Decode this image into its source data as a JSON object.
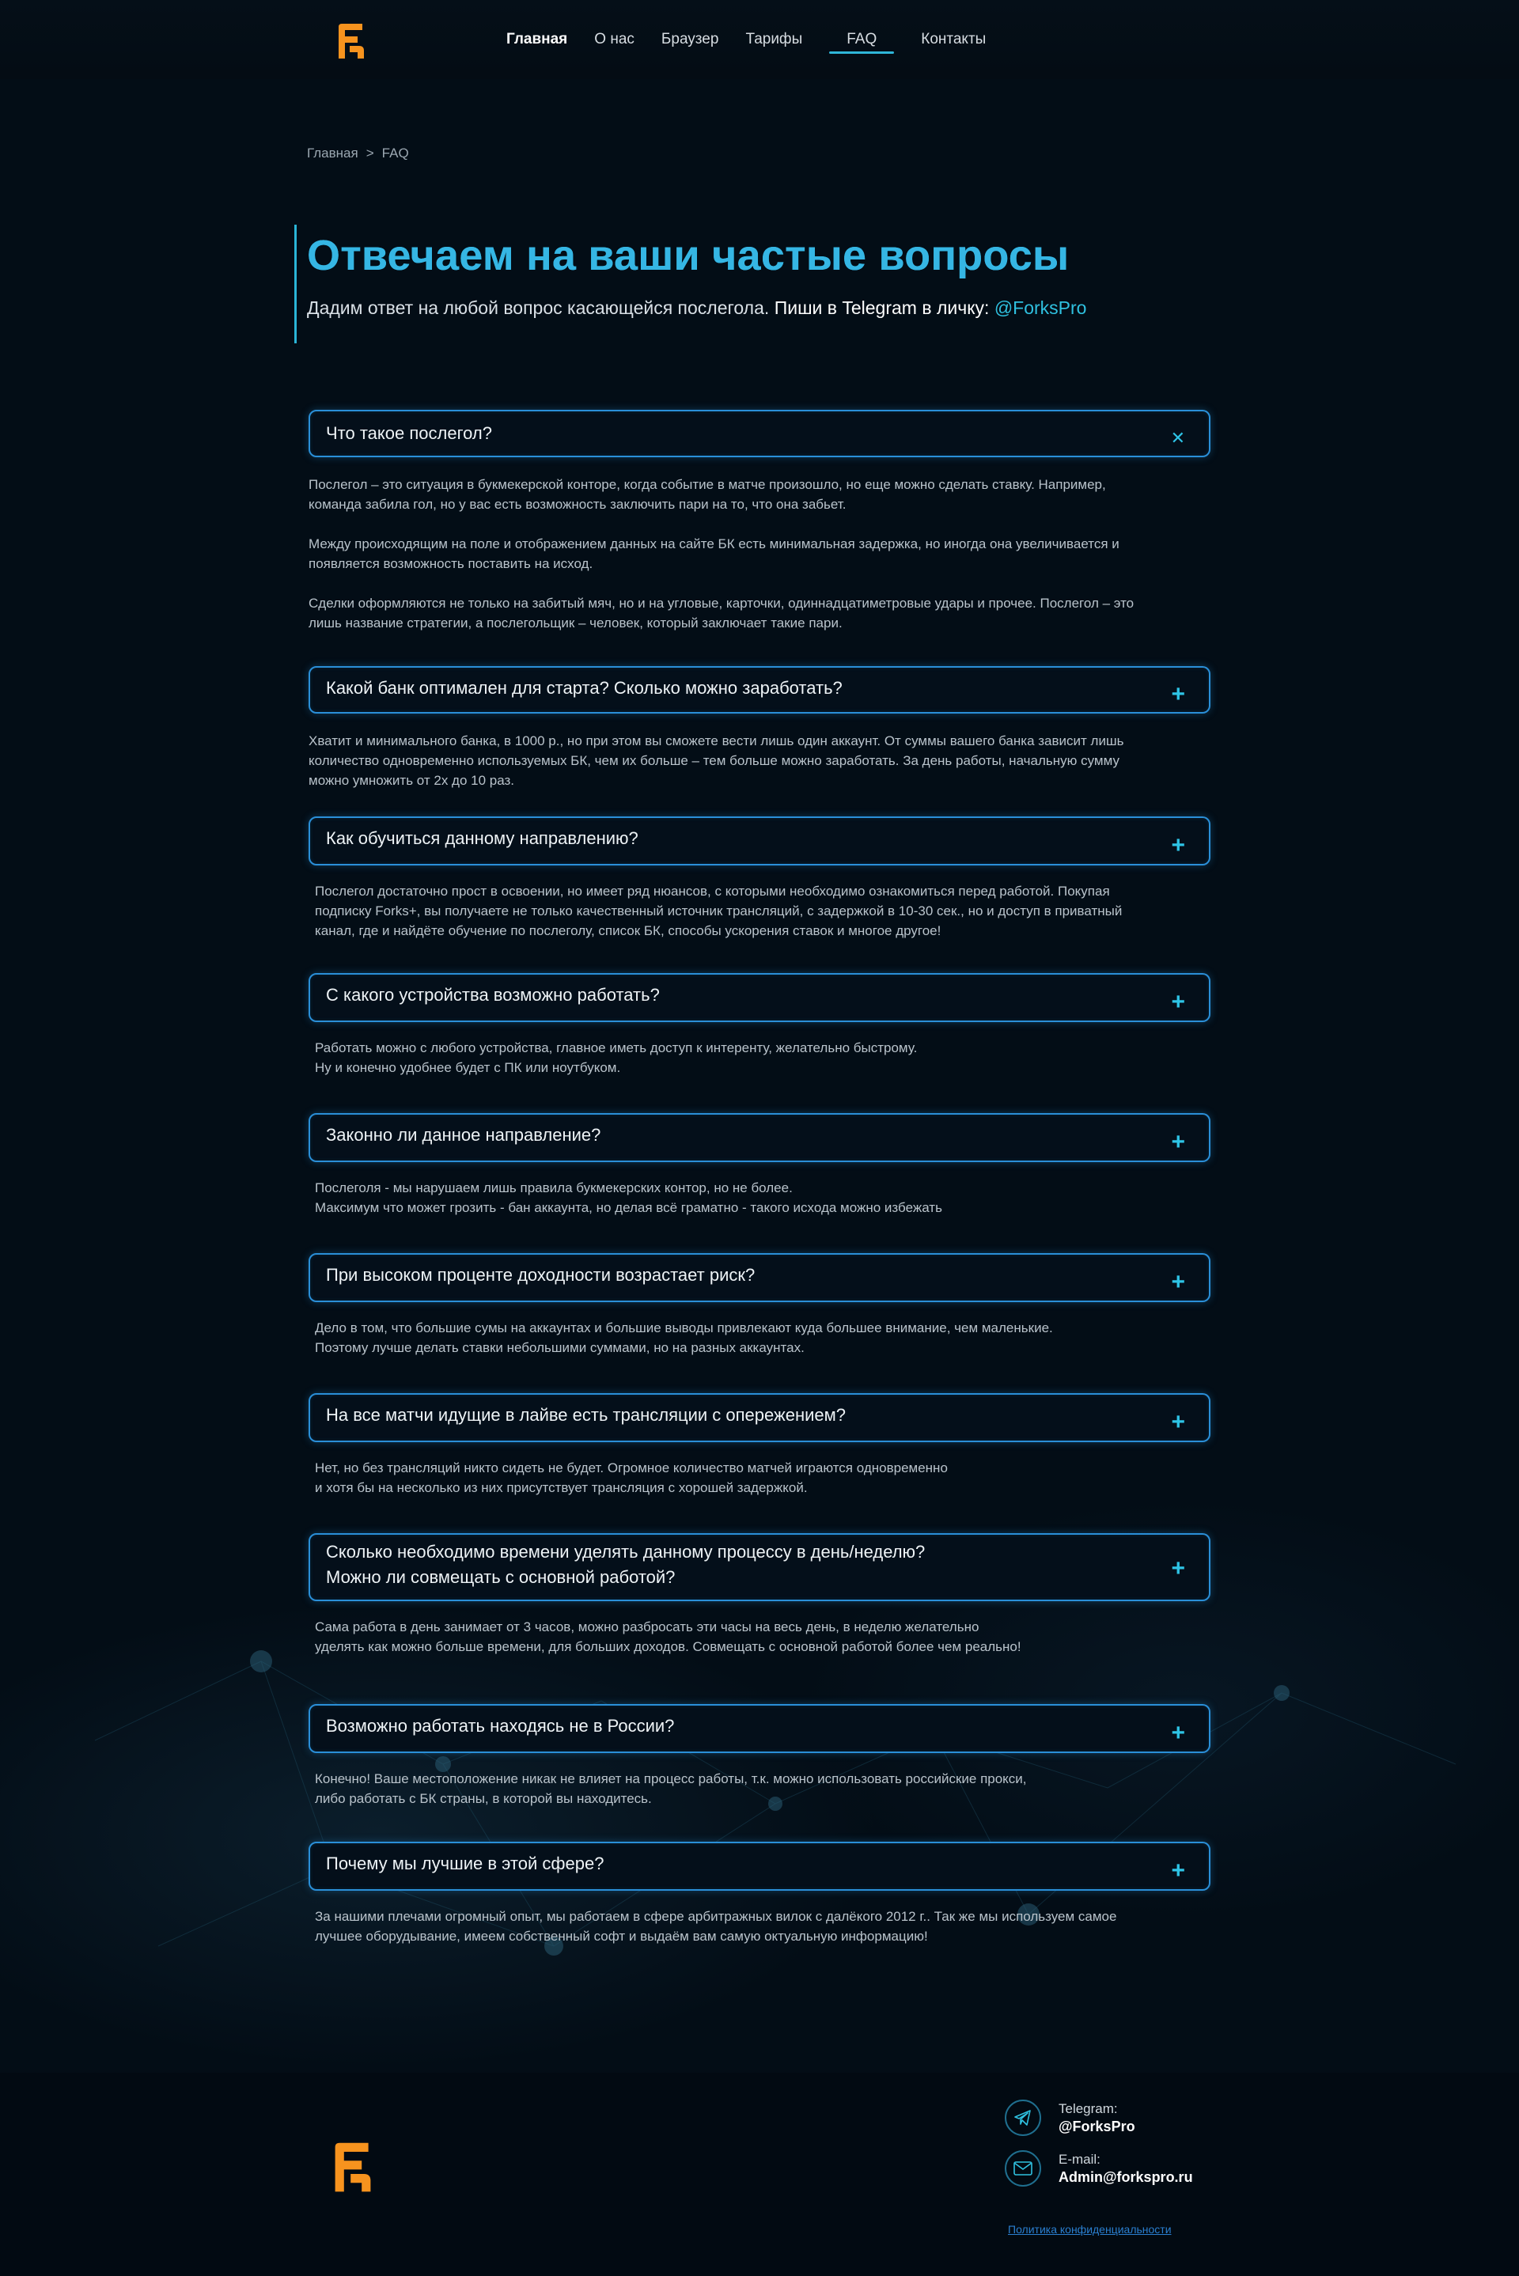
{
  "nav": {
    "items": [
      "Главная",
      "О нас",
      "Браузер",
      "Тарифы",
      "FAQ",
      "Контакты"
    ],
    "active": "FAQ"
  },
  "breadcrumb": {
    "home": "Главная",
    "separator": ">",
    "current": "FAQ"
  },
  "hero": {
    "title": "Отвечаем на ваши частые вопросы",
    "subtitle_plain": "Дадим ответ на любой вопрос касающейся послегола.",
    "subtitle_tg": "Пиши в Telegram в личку:",
    "handle": "@ForksPro"
  },
  "faq": [
    {
      "question": [
        "Что такое послегол?"
      ],
      "open": true,
      "answer": [
        "Послегол – это ситуация в букмекерской конторе, когда событие в матче произошло, но еще можно сделать ставку. Например,",
        "команда забила гол, но у вас есть возможность заключить пари на то, что она забьет.",
        "",
        "Между происходящим на поле и отображением данных на сайте БК есть минимальная задержка, но иногда она увеличивается и",
        "появляется возможность поставить на исход.",
        "",
        "Сделки оформляются не только на забитый мяч, но и на угловые, карточки, одиннадцатиметровые удары и прочее. Послегол – это",
        "лишь название стратегии, а послегольщик – человек, который заключает такие пари."
      ]
    },
    {
      "question": [
        "Какой банк оптимален для старта? Сколько можно заработать?"
      ],
      "open": false,
      "answer": [
        "Хватит и минимального банка, в 1000 р., но при этом вы сможете вести лишь один аккаунт. От суммы вашего банка зависит лишь",
        "количество одновременно используемых БК, чем их больше – тем больше можно заработать. За день работы, начальную сумму",
        "можно умножить от 2х до 10 раз."
      ]
    },
    {
      "question": [
        "Как обучиться данному направлению?"
      ],
      "open": false,
      "answer": [
        "Послегол достаточно прост в освоении, но имеет ряд нюансов, с которыми необходимо ознакомиться перед работой. Покупая",
        "подписку Forks+, вы получаете не только качественный источник трансляций, с задержкой в 10-30 сек., но и доступ в приватный",
        "канал, где и найдёте обучение по послеголу, список БК, способы ускорения ставок и многое другое!"
      ]
    },
    {
      "question": [
        "С какого устройства возможно работать?"
      ],
      "open": false,
      "answer": [
        "Работать можно с любого устройства, главное иметь доступ к интеренту, желательно быстрому.",
        "Ну и конечно удобнее будет с ПК или ноутбуком."
      ]
    },
    {
      "question": [
        "Законно ли данное направление?"
      ],
      "open": false,
      "answer": [
        "Послеголя - мы нарушаем лишь правила букмекерских контор, но не более.",
        "Максимум что может грозить - бан аккаунта, но делая всё граматно - такого исхода можно избежать"
      ]
    },
    {
      "question": [
        "При высоком проценте доходности возрастает риск?"
      ],
      "open": false,
      "answer": [
        "Дело в том, что большие сумы на аккаунтах и большие выводы привлекают куда большее внимание, чем маленькие.",
        "Поэтому лучше делать ставки небольшими суммами, но на разных аккаунтах."
      ]
    },
    {
      "question": [
        "На все матчи идущие в лайве есть трансляции с опережением?"
      ],
      "open": false,
      "answer": [
        "Нет, но без трансляций никто сидеть не будет. Огромное количество матчей играются одновременно",
        "и хотя бы на несколько из них присутствует трансляция с хорошей задержкой."
      ]
    },
    {
      "question": [
        "Сколько необходимо времени уделять данному процессу в день/неделю?",
        "Можно ли совмещать с основной работой?"
      ],
      "open": false,
      "answer": [
        "Сама работа в день занимает от 3 часов, можно разбросать эти часы на весь день, в неделю желательно",
        "уделять как можно больше времени, для больших доходов. Совмещать с основной работой более чем реально!"
      ]
    },
    {
      "question": [
        "Возможно работать находясь не в России?"
      ],
      "open": false,
      "answer": [
        "Конечно! Ваше местоположение никак не влияет на процесс работы, т.к. можно использовать российские прокси,",
        "либо работать с БК страны, в которой вы находитесь."
      ]
    },
    {
      "question": [
        "Почему мы лучшие в этой сфере?"
      ],
      "open": false,
      "answer": [
        "За нашими плечами огромный опыт, мы работаем в сфере арбитражных вилок с далёкого 2012 г.. Так же мы используем самое",
        "лучшее оборудывание, имеем собственный софт и выдаём вам самую октуальную информацию!"
      ]
    }
  ],
  "icons": {
    "open": "close-icon",
    "closed": "plus-icon"
  },
  "footer": {
    "telegram_label": "Telegram:",
    "telegram_value": "@ForksPro",
    "email_label": "E-mail:",
    "email_value": "Admin@forkspro.ru",
    "privacy": "Политика конфиденциальности"
  },
  "colors": {
    "accent": "#2fb6d8",
    "logo": "#f7931e",
    "background": "#030d16"
  }
}
